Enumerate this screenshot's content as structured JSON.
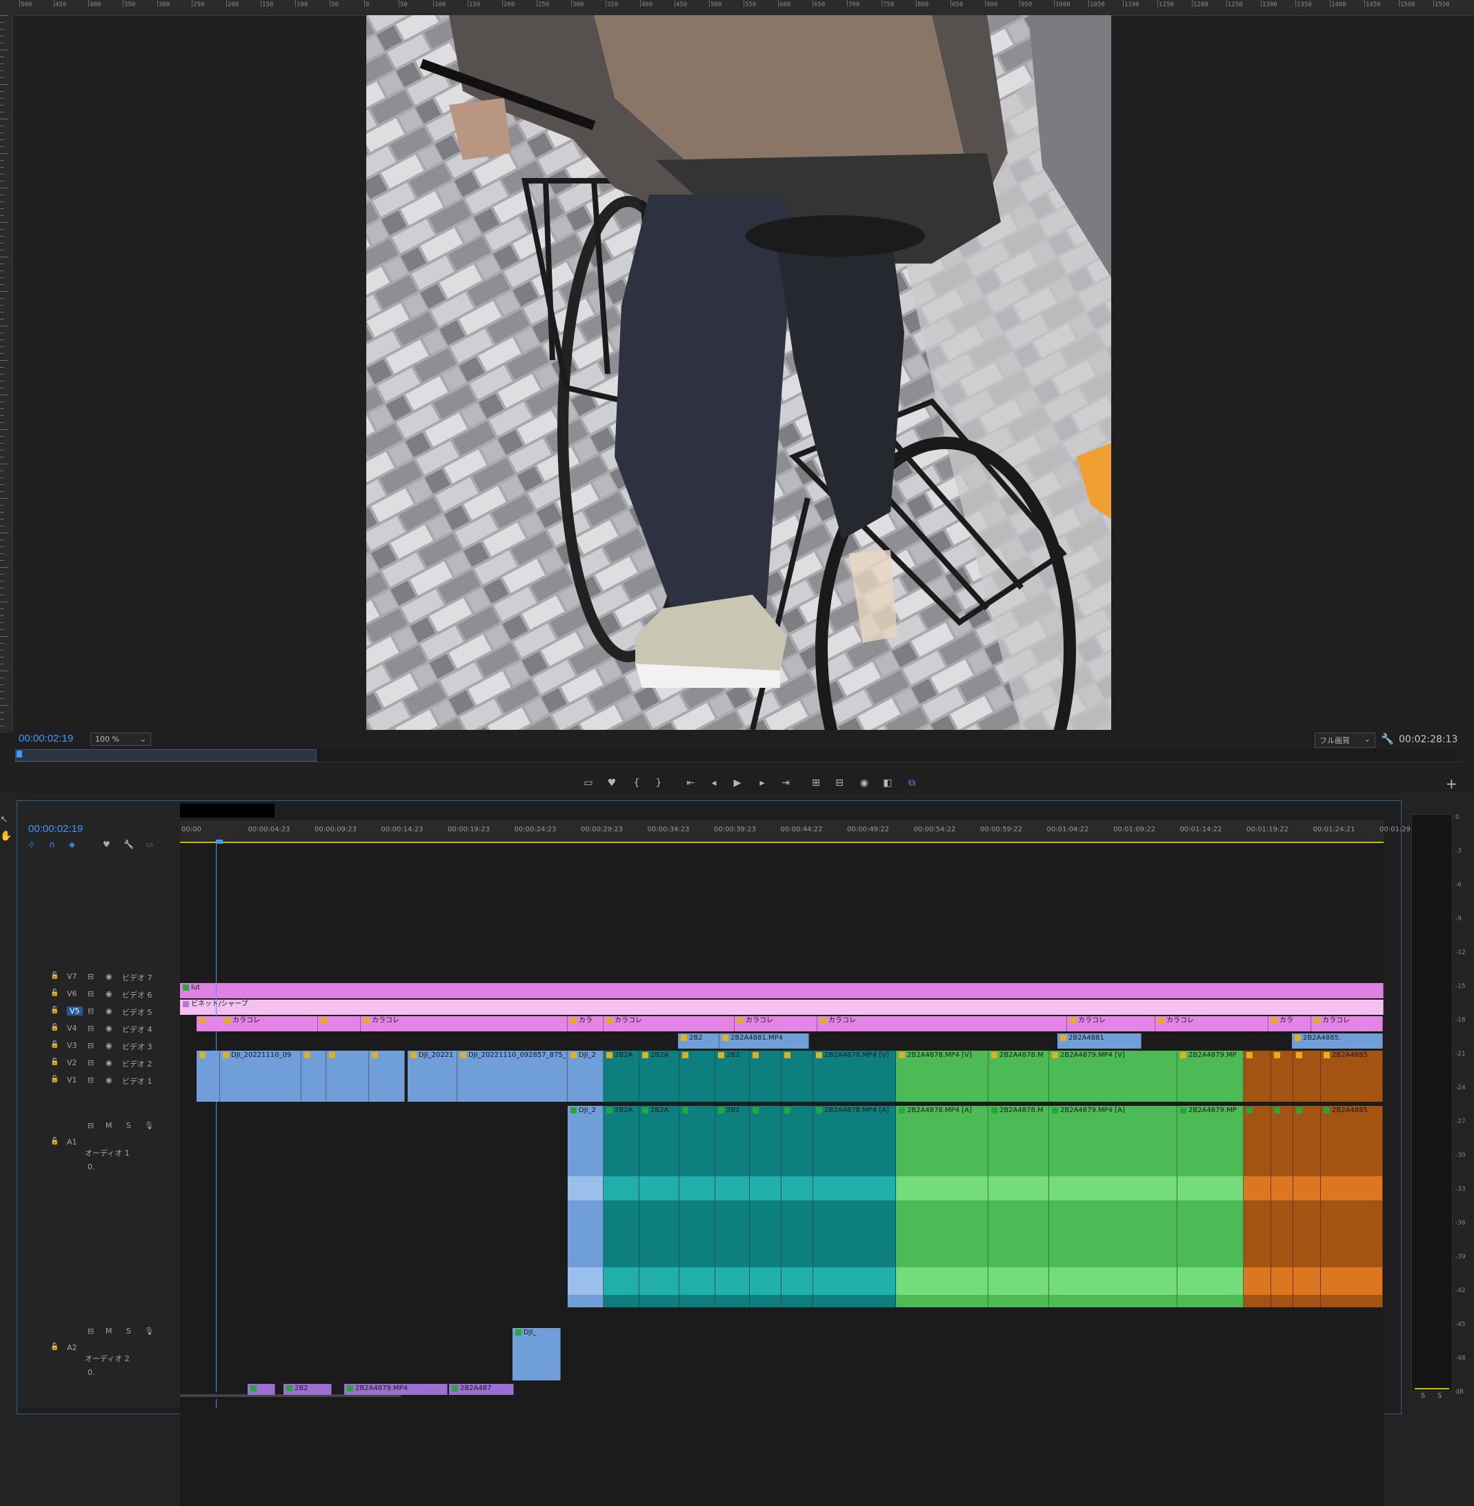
{
  "monitor": {
    "timecode_current": "00:00:02:19",
    "zoom": "100 %",
    "quality": "フル画質",
    "timecode_duration": "00:02:28:13",
    "ruler_labels": [
      "500",
      "450",
      "400",
      "350",
      "300",
      "250",
      "200",
      "150",
      "100",
      "50",
      "0",
      "50",
      "100",
      "150",
      "200",
      "250",
      "300",
      "350",
      "400",
      "450",
      "500",
      "550",
      "600",
      "650",
      "700",
      "750",
      "800",
      "850",
      "900",
      "950",
      "1000",
      "1050",
      "1100",
      "1150",
      "1200",
      "1250",
      "1300",
      "1350",
      "1400",
      "1450",
      "1500",
      "1550"
    ],
    "controls": [
      "add-marker",
      "mark-in",
      "mark-out",
      "go-to-in",
      "step-back",
      "play",
      "step-forward",
      "go-to-out",
      "lift",
      "extract",
      "export-frame",
      "comparison",
      "proxy"
    ]
  },
  "timeline": {
    "timecode": "00:00:02:19",
    "ruler": [
      "00:00",
      "00:00:04:23",
      "00:00:09:23",
      "00:00:14:23",
      "00:00:19:23",
      "00:00:24:23",
      "00:00:29:23",
      "00:00:34:23",
      "00:00:39:23",
      "00:00:44:22",
      "00:00:49:22",
      "00:00:54:22",
      "00:00:59:22",
      "00:01:04:22",
      "00:01:09:22",
      "00:01:14:22",
      "00:01:19:22",
      "00:01:24:21",
      "00:01:29"
    ],
    "tracks": [
      {
        "id": "V7",
        "name": "ビデオ 7"
      },
      {
        "id": "V6",
        "name": "ビデオ 6"
      },
      {
        "id": "V5",
        "name": "ビデオ 5"
      },
      {
        "id": "V4",
        "name": "ビデオ 4"
      },
      {
        "id": "V3",
        "name": "ビデオ 3"
      },
      {
        "id": "V2",
        "name": "ビデオ 2"
      },
      {
        "id": "V1",
        "name": "ビデオ 1"
      }
    ],
    "audio_tracks": [
      {
        "id": "A1",
        "name": "オーディオ 1",
        "level": "0."
      },
      {
        "id": "A2",
        "name": "オーディオ 2",
        "level": "0."
      }
    ],
    "clips": {
      "v6": "lut",
      "v5": "ビネット/シャープ",
      "v4": [
        "カラコレ",
        "カラコレ",
        "カラ",
        "カラコレ",
        "カラコレ",
        "カラコレ",
        "カラコレ",
        "カラコレ",
        "カラ",
        "カラコレ"
      ],
      "v2": [
        "2B2",
        "2B2A4881.MP4",
        "2B2A4881",
        "2B2A4885."
      ],
      "v1": [
        "DJI_20221110_09",
        "DJI_20221",
        "DJI_20221110_092857_875_vid",
        "DJI_2",
        "2B2A",
        "2B2A",
        "2B2",
        "2B2A4878.MP4 [V]",
        "2B2A4878.MP4 [V]",
        "2B2A4878.M",
        "2B2A4879.MP4 [V]",
        "2B2A4879.MP",
        "2B2A4885"
      ],
      "a1": [
        "DJI_2",
        "2B2A",
        "2B2A",
        "2B2",
        "2B2A4878.MP4 [A]",
        "2B2A4878.MP4 [A]",
        "2B2A4878.M",
        "2B2A4879.MP4 [A]",
        "2B2A4879.MP",
        "2B2A4885"
      ],
      "a2": [
        "DJI_"
      ],
      "a3": [
        "2B2",
        "2B2A4879.MP4",
        "2B2A487"
      ]
    },
    "meter_scale": [
      "0",
      "-3",
      "-6",
      "-9",
      "-12",
      "-15",
      "-18",
      "-21",
      "-24",
      "-27",
      "-30",
      "-33",
      "-36",
      "-39",
      "-42",
      "-45",
      "-48",
      "dB"
    ],
    "meter_solo": [
      "S",
      "S"
    ],
    "track_toggles": {
      "mute": "M",
      "solo": "S"
    }
  },
  "colors": {
    "accent": "#3b9bff",
    "video_blue": "#6f9ed8",
    "teal": "#0d7f7f",
    "green": "#4cbb55",
    "orange": "#a35312",
    "pink": "#e080e0",
    "lut": "#de82e2",
    "vignette": "#f7bff5"
  }
}
